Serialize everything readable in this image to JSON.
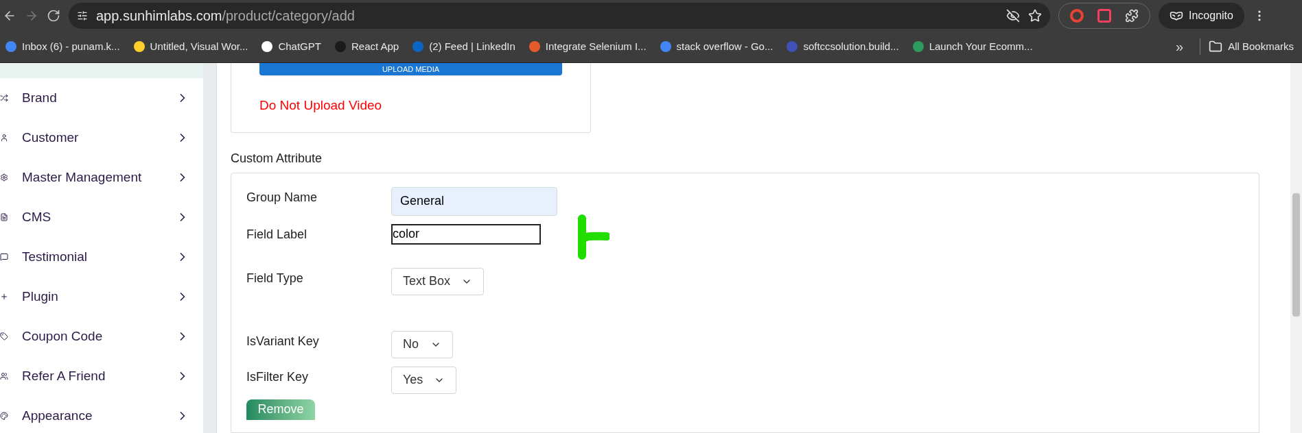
{
  "browser": {
    "url_host": "app.sunhimlabs.com",
    "url_path": "/product/category/add",
    "profile": "Incognito",
    "bookmarks": [
      {
        "title": "Inbox (6) - punam.k..."
      },
      {
        "title": "Untitled, Visual Wor..."
      },
      {
        "title": "ChatGPT"
      },
      {
        "title": "React App"
      },
      {
        "title": "(2) Feed | LinkedIn"
      },
      {
        "title": "Integrate Selenium I..."
      },
      {
        "title": "stack overflow - Go..."
      },
      {
        "title": "softccsolution.build..."
      },
      {
        "title": "Launch Your Ecomm..."
      }
    ],
    "overflow": "»",
    "all_bookmarks": "All Bookmarks"
  },
  "sidebar": {
    "items": [
      {
        "label": "Brand"
      },
      {
        "label": "Customer"
      },
      {
        "label": "Master Management"
      },
      {
        "label": "CMS"
      },
      {
        "label": "Testimonial"
      },
      {
        "label": "Plugin"
      },
      {
        "label": "Coupon Code"
      },
      {
        "label": "Refer A Friend"
      },
      {
        "label": "Appearance"
      }
    ]
  },
  "media": {
    "upload_button": "UPLOAD MEDIA",
    "warning": "Do Not Upload Video"
  },
  "custom_attribute": {
    "title": "Custom Attribute",
    "fields": [
      {
        "kind": "text",
        "label": "Group Name",
        "value": "General",
        "autofilled": true,
        "focused": false
      },
      {
        "kind": "text",
        "label": "Field Label",
        "value": "color",
        "autofilled": false,
        "focused": true
      },
      {
        "kind": "select",
        "label": "Field Type",
        "value": "Text Box"
      },
      {
        "kind": "select",
        "label": "IsVariant Key",
        "value": "No"
      },
      {
        "kind": "select",
        "label": "IsFilter Key",
        "value": "Yes"
      }
    ],
    "remove_button": "Remove"
  }
}
